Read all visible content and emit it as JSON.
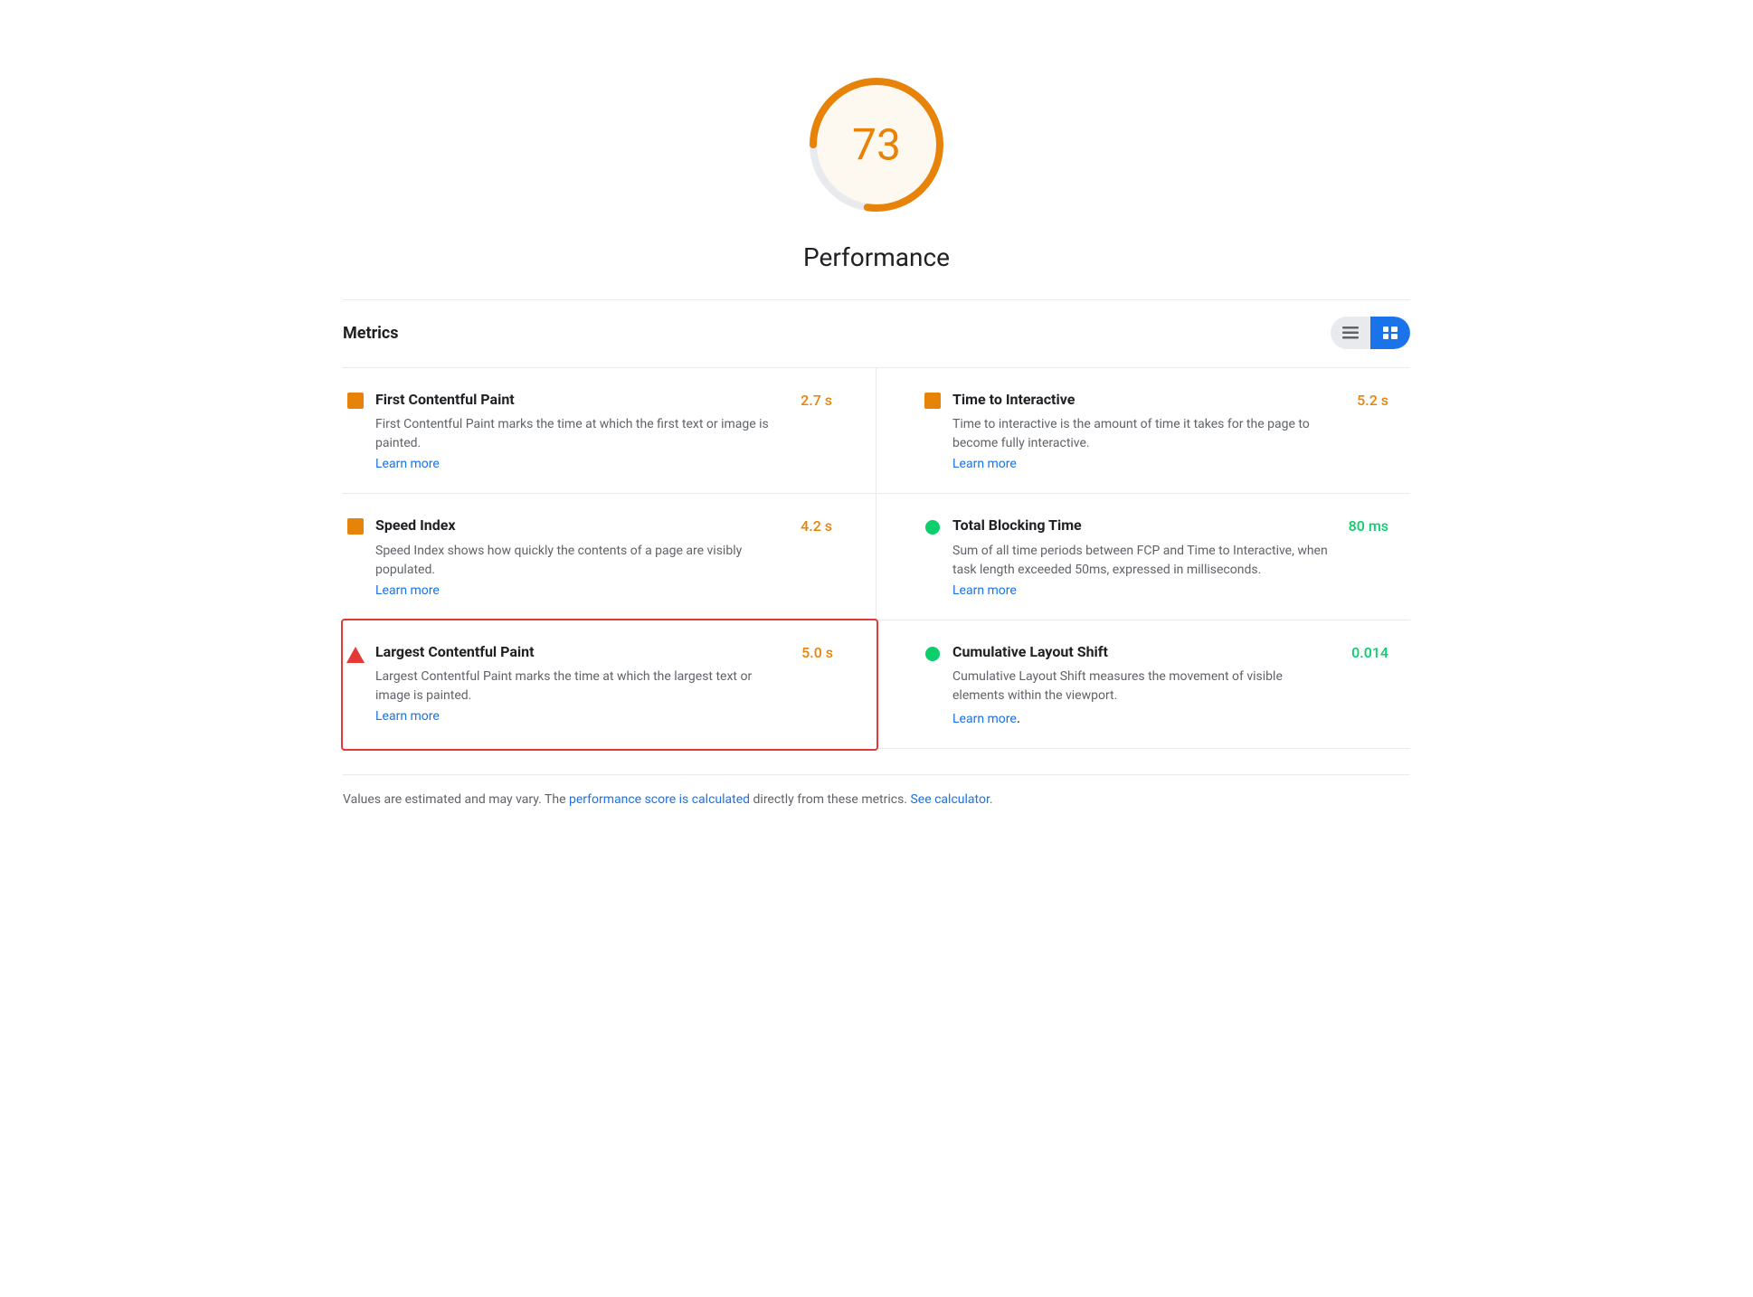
{
  "score": {
    "value": "73",
    "label": "Performance",
    "color": "#e8830a",
    "bg_color": "#fef9f0"
  },
  "metrics_header": {
    "title": "Metrics",
    "toggle_list_label": "≡",
    "toggle_grid_label": "≡"
  },
  "metrics": [
    {
      "id": "fcp",
      "name": "First Contentful Paint",
      "description": "First Contentful Paint marks the time at which the first text or image is painted.",
      "learn_more_text": "Learn more",
      "learn_more_href": "#",
      "value": "2.7 s",
      "value_color": "orange",
      "icon_type": "square",
      "icon_color": "orange",
      "highlighted": false,
      "col": "left"
    },
    {
      "id": "tti",
      "name": "Time to Interactive",
      "description": "Time to interactive is the amount of time it takes for the page to become fully interactive.",
      "learn_more_text": "Learn more",
      "learn_more_href": "#",
      "value": "5.2 s",
      "value_color": "orange",
      "icon_type": "square",
      "icon_color": "orange",
      "highlighted": false,
      "col": "right"
    },
    {
      "id": "si",
      "name": "Speed Index",
      "description": "Speed Index shows how quickly the contents of a page are visibly populated.",
      "learn_more_text": "Learn more",
      "learn_more_href": "#",
      "value": "4.2 s",
      "value_color": "orange",
      "icon_type": "square",
      "icon_color": "orange",
      "highlighted": false,
      "col": "left"
    },
    {
      "id": "tbt",
      "name": "Total Blocking Time",
      "description": "Sum of all time periods between FCP and Time to Interactive, when task length exceeded 50ms, expressed in milliseconds.",
      "learn_more_text": "Learn more",
      "learn_more_href": "#",
      "value": "80 ms",
      "value_color": "green",
      "icon_type": "circle",
      "icon_color": "green",
      "highlighted": false,
      "col": "right"
    },
    {
      "id": "lcp",
      "name": "Largest Contentful Paint",
      "description": "Largest Contentful Paint marks the time at which the largest text or image is painted.",
      "learn_more_text": "Learn more",
      "learn_more_href": "#",
      "value": "5.0 s",
      "value_color": "orange",
      "icon_type": "triangle",
      "icon_color": "red",
      "highlighted": true,
      "col": "left"
    },
    {
      "id": "cls",
      "name": "Cumulative Layout Shift",
      "description": "Cumulative Layout Shift measures the movement of visible elements within the viewport.",
      "learn_more_text": "Learn more",
      "learn_more_href": "#",
      "value": "0.014",
      "value_color": "green",
      "icon_type": "circle",
      "icon_color": "green",
      "highlighted": false,
      "col": "right"
    }
  ],
  "footer": {
    "prefix": "Values are estimated and may vary. The ",
    "link1_text": "performance score is calculated",
    "link1_href": "#",
    "middle": " directly from these metrics. ",
    "link2_text": "See calculator.",
    "link2_href": "#"
  }
}
